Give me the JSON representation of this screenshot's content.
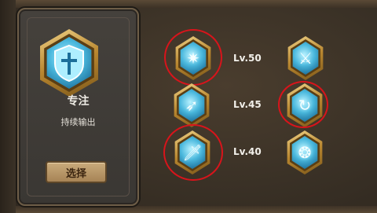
{
  "talent": {
    "title": "专注",
    "subtitle": "持续输出",
    "select_label": "选择",
    "emblem_icon": "focus-shield-icon"
  },
  "levels": [
    {
      "label": "Lv.50",
      "left_icon": "shatter-burst-icon",
      "right_icon": "crossed-blades-icon",
      "left_highlighted": true,
      "right_highlighted": false
    },
    {
      "label": "Lv.45",
      "left_icon": "slash-wing-icon",
      "right_icon": "swirl-strike-icon",
      "left_highlighted": false,
      "right_highlighted": true
    },
    {
      "label": "Lv.40",
      "left_icon": "dagger-icon",
      "right_icon": "scroll-icon",
      "left_highlighted": true,
      "right_highlighted": false
    }
  ],
  "colors": {
    "highlight_ring": "#d8141b",
    "gold_frame": "#c9973a",
    "ice_gem": "#4ab8dd"
  }
}
